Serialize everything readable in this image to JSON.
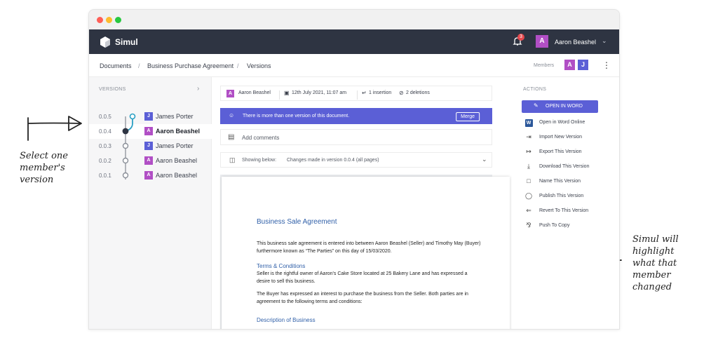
{
  "annotations": {
    "left": "Select one member's version",
    "right": "Simul will highlight what that member changed"
  },
  "colors": {
    "appbar": "#2e3442",
    "accent": "#5b5fd6",
    "avatar_a": "#b14fc5",
    "avatar_j": "#5b5fd6",
    "tree_active": "#2ba0c4"
  },
  "app": {
    "name": "Simul",
    "notification_count": "3",
    "user_initial": "A",
    "user_name": "Aaron Beashel"
  },
  "breadcrumb": [
    "Documents",
    "Business Purchase Agreement",
    "Versions"
  ],
  "members": {
    "label": "Members",
    "items": [
      {
        "initial": "A"
      },
      {
        "initial": "J"
      }
    ]
  },
  "versions": {
    "title": "VERSIONS",
    "items": [
      {
        "number": "0.0.5",
        "initial": "J",
        "name": "James Porter",
        "selected": false
      },
      {
        "number": "0.0.4",
        "initial": "A",
        "name": "Aaron Beashel",
        "selected": true
      },
      {
        "number": "0.0.3",
        "initial": "J",
        "name": "James Porter",
        "selected": false
      },
      {
        "number": "0.0.2",
        "initial": "A",
        "name": "Aaron Beashel",
        "selected": false
      },
      {
        "number": "0.0.1",
        "initial": "A",
        "name": "Aaron Beashel",
        "selected": false
      }
    ]
  },
  "meta": {
    "initial": "A",
    "author": "Aaron Beashel",
    "date": "12th July 2021, 11:07 am",
    "insertions": "1 insertion",
    "deletions": "2 deletions"
  },
  "banner": {
    "text": "There is more than one version of this document.",
    "button": "Merge"
  },
  "comments": {
    "label": "Add comments"
  },
  "showing": {
    "label": "Showing below:",
    "value": "Changes made in version 0.0.4 (all pages)"
  },
  "document": {
    "title": "Business Sale Agreement",
    "para1": "This business sale agreement is entered into between Aaron Beashel (Seller) and Timothy May (Buyer) furthermore known as “The Parties” on this day of 15/03/2020.",
    "heading1": "Terms & Conditions",
    "para2": "Seller is the rightful owner of Aaron's Cake Store located at 25 Bakery Lane and has expressed a desire to sell this business.",
    "para3": "The Buyer has expressed an interest to purchase the business from the Seller. Both parties are in agreement to the following terms and conditions:",
    "heading2": "Description of Business"
  },
  "actions": {
    "title": "ACTIONS",
    "primary": "OPEN IN WORD",
    "items": [
      {
        "label": "Open in Word Online",
        "icon": "word-icon"
      },
      {
        "label": "Import New Version",
        "icon": "import-icon"
      },
      {
        "label": "Export This Version",
        "icon": "export-icon"
      },
      {
        "label": "Download This Version",
        "icon": "download-icon"
      },
      {
        "label": "Name This Version",
        "icon": "bookmark-icon"
      },
      {
        "label": "Publish This Version",
        "icon": "publish-icon"
      },
      {
        "label": "Revert To This Version",
        "icon": "revert-icon"
      },
      {
        "label": "Push To Copy",
        "icon": "push-icon"
      }
    ]
  }
}
